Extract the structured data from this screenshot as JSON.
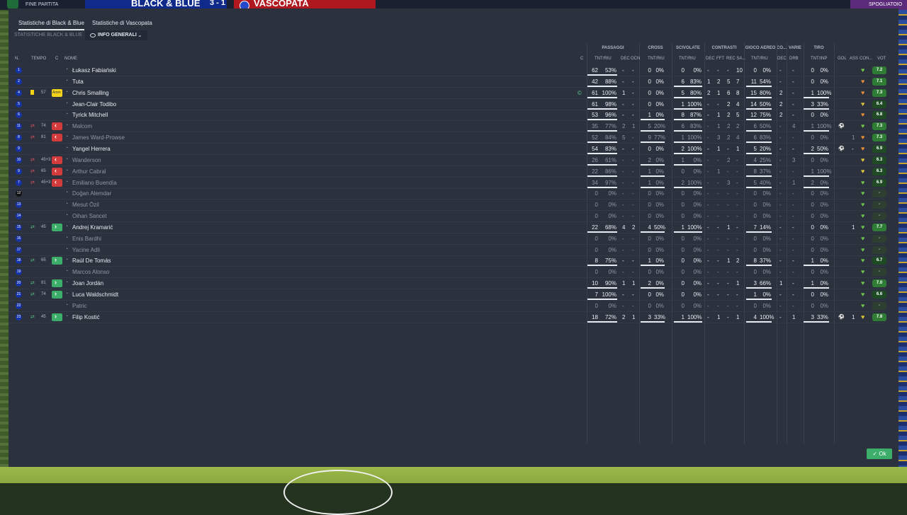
{
  "topbar": {
    "status": "FINE PARTITA",
    "home_team": "BLACK & BLUE",
    "score": "3 - 1",
    "away_team": "VASCOPATA",
    "right_label": "SPOGLIATOIO"
  },
  "tabs": [
    {
      "label": "Statistiche di Black & Blue",
      "active": true
    },
    {
      "label": "Statistiche di Vascopata",
      "active": false
    }
  ],
  "subtitle": "STATISTICHE BLACK & BLUE",
  "view_dropdown": {
    "label": "INFO GENERALI",
    "icon": "eye-icon"
  },
  "groups": [
    "PASSAGGI",
    "CROSS",
    "SCIVOLATE",
    "CONTRASTI",
    "GIOCO AEREO",
    "CO...",
    "VARIE",
    "TIRO"
  ],
  "headers": {
    "n": "N.",
    "tempo": "TEMPO",
    "c": "C",
    "nome": "NOME",
    "cap": "C",
    "pass": "TNT/RIU",
    "dec": "DEC",
    "ocn": "OCN",
    "cross": "TNT/RIU",
    "sciv": "TNT/RIU",
    "cdec": "DEC",
    "fft": "FFT",
    "rec": "REC SA...",
    "aereo": "TNT/RIU",
    "codec": "DEC",
    "drb": "DRB",
    "tiro": "TNT/INP",
    "gol": "GOL",
    "ass": "ASS",
    "con": "CON...",
    "vot": "VOT"
  },
  "players": [
    {
      "num": "1",
      "name": "Łukasz Fabiański",
      "p": [
        "62",
        "53%"
      ],
      "pd": [
        "-",
        "-"
      ],
      "c": [
        "0",
        "0%"
      ],
      "s": [
        "0",
        "0%"
      ],
      "ct": [
        "-",
        "-",
        "-",
        "10"
      ],
      "a": [
        "0",
        "0%"
      ],
      "cd": "-",
      "d": "-",
      "t": [
        "0",
        "0%"
      ],
      "g": "",
      "as": "",
      "con": "green",
      "vote": "7.2"
    },
    {
      "num": "2",
      "name": "Tuta",
      "p": [
        "42",
        "88%"
      ],
      "pd": [
        "-",
        "-"
      ],
      "c": [
        "0",
        "0%"
      ],
      "s": [
        "6",
        "83%"
      ],
      "ct": [
        "1",
        "2",
        "5",
        "7"
      ],
      "a": [
        "11",
        "54%"
      ],
      "cd": "-",
      "d": "-",
      "t": [
        "0",
        "0%"
      ],
      "g": "",
      "as": "",
      "con": "orange",
      "vote": "7.1"
    },
    {
      "num": "4",
      "name": "Chris Smalling",
      "yc": true,
      "min": "57",
      "badge": "yellow",
      "badge_text": "Amm",
      "p": [
        "61",
        "100%"
      ],
      "pd": [
        "1",
        "-"
      ],
      "c": [
        "0",
        "0%"
      ],
      "s": [
        "5",
        "80%"
      ],
      "ct": [
        "2",
        "1",
        "6",
        "8"
      ],
      "a": [
        "15",
        "80%"
      ],
      "cd": "2",
      "d": "-",
      "t": [
        "1",
        "100%"
      ],
      "g": "",
      "as": "",
      "con": "orange",
      "vote": "7.3",
      "cap": true
    },
    {
      "num": "5",
      "name": "Jean-Clair Todibo",
      "p": [
        "61",
        "98%"
      ],
      "pd": [
        "-",
        "-"
      ],
      "c": [
        "0",
        "0%"
      ],
      "s": [
        "1",
        "100%"
      ],
      "ct": [
        "-",
        "-",
        "2",
        "4"
      ],
      "a": [
        "14",
        "50%"
      ],
      "cd": "2",
      "d": "-",
      "t": [
        "3",
        "33%"
      ],
      "g": "",
      "as": "",
      "con": "yellow",
      "vote": "6.4"
    },
    {
      "num": "6",
      "name": "Tyrick Mitchell",
      "p": [
        "53",
        "96%"
      ],
      "pd": [
        "-",
        "-"
      ],
      "c": [
        "1",
        "0%"
      ],
      "s": [
        "8",
        "87%"
      ],
      "ct": [
        "-",
        "1",
        "2",
        "5"
      ],
      "a": [
        "12",
        "75%"
      ],
      "cd": "2",
      "d": "-",
      "t": [
        "0",
        "0%"
      ],
      "g": "",
      "as": "",
      "con": "orange",
      "vote": "6.8"
    },
    {
      "num": "11",
      "name": "Malcom",
      "dim": true,
      "sub": "off",
      "min": "74",
      "badge": "red",
      "p": [
        "35",
        "77%"
      ],
      "pd": [
        "2",
        "1"
      ],
      "c": [
        "5",
        "20%"
      ],
      "s": [
        "6",
        "83%"
      ],
      "ct": [
        "-",
        "1",
        "2",
        "2"
      ],
      "a": [
        "6",
        "50%"
      ],
      "cd": "-",
      "d": "4",
      "t": [
        "1",
        "100%"
      ],
      "g": "ball",
      "as": "",
      "con": "green",
      "vote": "7.3"
    },
    {
      "num": "8",
      "name": "James Ward-Prowse",
      "dim": true,
      "sub": "off",
      "min": "81",
      "badge": "red",
      "p": [
        "52",
        "84%"
      ],
      "pd": [
        "5",
        "-"
      ],
      "c": [
        "9",
        "77%"
      ],
      "s": [
        "1",
        "100%"
      ],
      "ct": [
        "-",
        "3",
        "2",
        "4"
      ],
      "a": [
        "6",
        "83%"
      ],
      "cd": "-",
      "d": "-",
      "t": [
        "0",
        "0%"
      ],
      "g": "",
      "as": "1",
      "con": "orange",
      "vote": "7.3"
    },
    {
      "num": "9",
      "name": "Yangel Herrera",
      "p": [
        "54",
        "83%"
      ],
      "pd": [
        "-",
        "-"
      ],
      "c": [
        "0",
        "0%"
      ],
      "s": [
        "2",
        "100%"
      ],
      "ct": [
        "-",
        "1",
        "-",
        "1"
      ],
      "a": [
        "5",
        "20%"
      ],
      "cd": "-",
      "d": "-",
      "t": [
        "2",
        "50%"
      ],
      "g": "ball",
      "as": "-",
      "con": "orange",
      "vote": "6.9"
    },
    {
      "num": "10",
      "name": "Wanderson",
      "dim": true,
      "sub": "off",
      "min": "45+3",
      "badge": "red",
      "p": [
        "26",
        "61%"
      ],
      "pd": [
        "-",
        "-"
      ],
      "c": [
        "2",
        "0%"
      ],
      "s": [
        "1",
        "0%"
      ],
      "ct": [
        "-",
        "-",
        "2",
        "-"
      ],
      "a": [
        "4",
        "25%"
      ],
      "cd": "-",
      "d": "3",
      "t": [
        "0",
        "0%"
      ],
      "g": "",
      "as": "",
      "con": "yellow",
      "vote": "6.3"
    },
    {
      "num": "9",
      "name": "Arthur Cabral",
      "dim": true,
      "sub": "off",
      "min": "65",
      "badge": "red",
      "p": [
        "22",
        "86%"
      ],
      "pd": [
        "-",
        "-"
      ],
      "c": [
        "1",
        "0%"
      ],
      "s": [
        "0",
        "0%"
      ],
      "ct": [
        "-",
        "1",
        "-",
        "-"
      ],
      "a": [
        "8",
        "37%"
      ],
      "cd": "-",
      "d": "-",
      "t": [
        "1",
        "100%"
      ],
      "g": "",
      "as": "",
      "con": "yellow",
      "vote": "6.3"
    },
    {
      "num": "7",
      "name": "Emiliano Buendía",
      "dim": true,
      "sub": "off",
      "min": "45+3",
      "badge": "red",
      "p": [
        "34",
        "97%"
      ],
      "pd": [
        "-",
        "-"
      ],
      "c": [
        "1",
        "0%"
      ],
      "s": [
        "2",
        "100%"
      ],
      "ct": [
        "-",
        "-",
        "3",
        "-"
      ],
      "a": [
        "5",
        "40%"
      ],
      "cd": "-",
      "d": "1",
      "t": [
        "2",
        "0%"
      ],
      "g": "",
      "as": "",
      "con": "green",
      "vote": "6.9"
    },
    {
      "num": "12",
      "name": "Doğan Alemdar",
      "dim": true,
      "dark": true,
      "p": [
        "0",
        "0%"
      ],
      "pd": [
        "-",
        "-"
      ],
      "c": [
        "0",
        "0%"
      ],
      "s": [
        "0",
        "0%"
      ],
      "ct": [
        "-",
        "-",
        "-",
        "-"
      ],
      "a": [
        "0",
        "0%"
      ],
      "cd": "-",
      "d": "-",
      "t": [
        "0",
        "0%"
      ],
      "g": "",
      "as": "",
      "con": "green",
      "vote": "-"
    },
    {
      "num": "13",
      "name": "Mesut Özil",
      "dim": true,
      "p": [
        "0",
        "0%"
      ],
      "pd": [
        "-",
        "-"
      ],
      "c": [
        "0",
        "0%"
      ],
      "s": [
        "0",
        "0%"
      ],
      "ct": [
        "-",
        "-",
        "-",
        "-"
      ],
      "a": [
        "0",
        "0%"
      ],
      "cd": "-",
      "d": "-",
      "t": [
        "0",
        "0%"
      ],
      "g": "",
      "as": "",
      "con": "green",
      "vote": "-"
    },
    {
      "num": "14",
      "name": "Oihan Sancet",
      "dim": true,
      "p": [
        "0",
        "0%"
      ],
      "pd": [
        "-",
        "-"
      ],
      "c": [
        "0",
        "0%"
      ],
      "s": [
        "0",
        "0%"
      ],
      "ct": [
        "-",
        "-",
        "-",
        "-"
      ],
      "a": [
        "0",
        "0%"
      ],
      "cd": "-",
      "d": "-",
      "t": [
        "0",
        "0%"
      ],
      "g": "",
      "as": "",
      "con": "green",
      "vote": "-"
    },
    {
      "num": "15",
      "name": "Andrej Kramarić",
      "sub": "on",
      "min": "45",
      "badge": "green",
      "p": [
        "22",
        "68%"
      ],
      "pd": [
        "4",
        "2"
      ],
      "c": [
        "4",
        "50%"
      ],
      "s": [
        "1",
        "100%"
      ],
      "ct": [
        "-",
        "-",
        "1",
        "-"
      ],
      "a": [
        "7",
        "14%"
      ],
      "cd": "-",
      "d": "-",
      "t": [
        "0",
        "0%"
      ],
      "g": "",
      "as": "1",
      "con": "green",
      "vote": "7.7"
    },
    {
      "num": "16",
      "name": "Enis Bardhi",
      "dim": true,
      "p": [
        "0",
        "0%"
      ],
      "pd": [
        "-",
        "-"
      ],
      "c": [
        "0",
        "0%"
      ],
      "s": [
        "0",
        "0%"
      ],
      "ct": [
        "-",
        "-",
        "-",
        "-"
      ],
      "a": [
        "0",
        "0%"
      ],
      "cd": "-",
      "d": "-",
      "t": [
        "0",
        "0%"
      ],
      "g": "",
      "as": "",
      "con": "green",
      "vote": "-"
    },
    {
      "num": "17",
      "name": "Yacine Adli",
      "dim": true,
      "p": [
        "0",
        "0%"
      ],
      "pd": [
        "-",
        "-"
      ],
      "c": [
        "0",
        "0%"
      ],
      "s": [
        "0",
        "0%"
      ],
      "ct": [
        "-",
        "-",
        "-",
        "-"
      ],
      "a": [
        "0",
        "0%"
      ],
      "cd": "-",
      "d": "-",
      "t": [
        "0",
        "0%"
      ],
      "g": "",
      "as": "",
      "con": "green",
      "vote": "-"
    },
    {
      "num": "18",
      "name": "Raúl De Tomás",
      "sub": "on",
      "min": "65",
      "badge": "green",
      "p": [
        "8",
        "75%"
      ],
      "pd": [
        "-",
        "-"
      ],
      "c": [
        "1",
        "0%"
      ],
      "s": [
        "0",
        "0%"
      ],
      "ct": [
        "-",
        "-",
        "1",
        "2"
      ],
      "a": [
        "8",
        "37%"
      ],
      "cd": "-",
      "d": "-",
      "t": [
        "1",
        "0%"
      ],
      "g": "",
      "as": "",
      "con": "green",
      "vote": "6.7"
    },
    {
      "num": "19",
      "name": "Marcos Alonso",
      "dim": true,
      "p": [
        "0",
        "0%"
      ],
      "pd": [
        "-",
        "-"
      ],
      "c": [
        "0",
        "0%"
      ],
      "s": [
        "0",
        "0%"
      ],
      "ct": [
        "-",
        "-",
        "-",
        "-"
      ],
      "a": [
        "0",
        "0%"
      ],
      "cd": "-",
      "d": "-",
      "t": [
        "0",
        "0%"
      ],
      "g": "",
      "as": "",
      "con": "green",
      "vote": "-"
    },
    {
      "num": "20",
      "name": "Joan Jordán",
      "sub": "on",
      "min": "81",
      "badge": "green",
      "p": [
        "10",
        "90%"
      ],
      "pd": [
        "1",
        "1"
      ],
      "c": [
        "2",
        "0%"
      ],
      "s": [
        "0",
        "0%"
      ],
      "ct": [
        "-",
        "-",
        "-",
        "1"
      ],
      "a": [
        "3",
        "66%"
      ],
      "cd": "1",
      "d": "-",
      "t": [
        "1",
        "0%"
      ],
      "g": "",
      "as": "",
      "con": "green",
      "vote": "7.0"
    },
    {
      "num": "21",
      "name": "Luca Waldschmidt",
      "sub": "on",
      "min": "74",
      "badge": "green",
      "p": [
        "7",
        "100%"
      ],
      "pd": [
        "-",
        "-"
      ],
      "c": [
        "0",
        "0%"
      ],
      "s": [
        "0",
        "0%"
      ],
      "ct": [
        "-",
        "-",
        "-",
        "-"
      ],
      "a": [
        "1",
        "0%"
      ],
      "cd": "-",
      "d": "-",
      "t": [
        "0",
        "0%"
      ],
      "g": "",
      "as": "",
      "con": "green",
      "vote": "6.6"
    },
    {
      "num": "22",
      "name": "Patric",
      "dim": true,
      "p": [
        "0",
        "0%"
      ],
      "pd": [
        "-",
        "-"
      ],
      "c": [
        "0",
        "0%"
      ],
      "s": [
        "0",
        "0%"
      ],
      "ct": [
        "-",
        "-",
        "-",
        "-"
      ],
      "a": [
        "0",
        "0%"
      ],
      "cd": "-",
      "d": "-",
      "t": [
        "0",
        "0%"
      ],
      "g": "",
      "as": "",
      "con": "green",
      "vote": "-"
    },
    {
      "num": "23",
      "name": "Filip Kostić",
      "sub": "on",
      "min": "45",
      "badge": "green",
      "p": [
        "18",
        "72%"
      ],
      "pd": [
        "2",
        "1"
      ],
      "c": [
        "3",
        "33%"
      ],
      "s": [
        "1",
        "100%"
      ],
      "ct": [
        "-",
        "1",
        "-",
        "1"
      ],
      "a": [
        "4",
        "100%"
      ],
      "cd": "-",
      "d": "1",
      "t": [
        "3",
        "33%"
      ],
      "g": "ball",
      "as": "1",
      "con": "yellow",
      "vote": "7.8"
    }
  ],
  "ok_button": "Ok",
  "colors": {
    "panel": "#2b313d",
    "accent_green": "#3cae6a",
    "sub_off": "#d23b3b",
    "yellow_card": "#f3d313",
    "home": "#0f2a8a",
    "away": "#b01820"
  }
}
